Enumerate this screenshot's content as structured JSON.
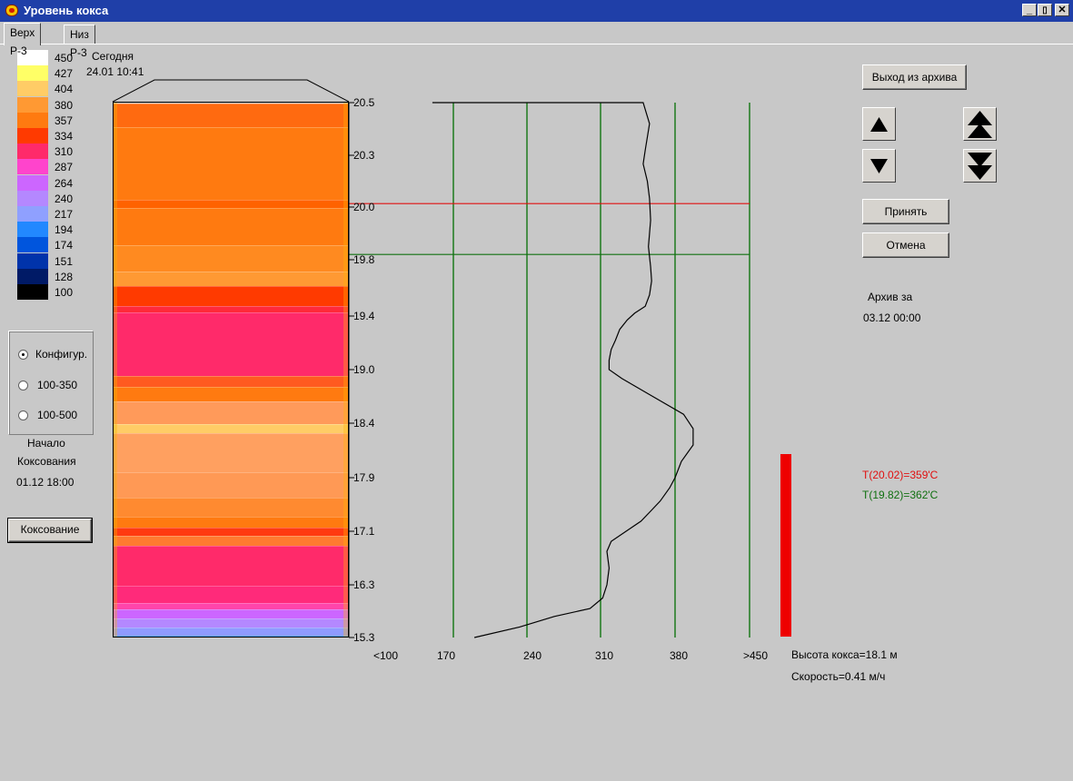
{
  "window": {
    "title": "Уровень кокса",
    "minimize": "_",
    "restore": "▯",
    "close": "✕"
  },
  "tabs": [
    {
      "label": "Верх Р-3",
      "active": true
    },
    {
      "label": "Низ Р-3",
      "active": false
    }
  ],
  "header": {
    "today_label": "Сегодня",
    "today_datetime": "24.01 10:41"
  },
  "legend": [
    {
      "value": "450",
      "color": "#ffffff"
    },
    {
      "value": "427",
      "color": "#ffff66"
    },
    {
      "value": "404",
      "color": "#ffcc66"
    },
    {
      "value": "380",
      "color": "#ff9933"
    },
    {
      "value": "357",
      "color": "#ff7a10"
    },
    {
      "value": "334",
      "color": "#ff3a00"
    },
    {
      "value": "310",
      "color": "#ff2a6a"
    },
    {
      "value": "287",
      "color": "#ff44cc"
    },
    {
      "value": "264",
      "color": "#cc66ff"
    },
    {
      "value": "240",
      "color": "#b488ff"
    },
    {
      "value": "217",
      "color": "#8fa0ff"
    },
    {
      "value": "194",
      "color": "#2288ff"
    },
    {
      "value": "174",
      "color": "#0055dd"
    },
    {
      "value": "151",
      "color": "#0033aa"
    },
    {
      "value": "128",
      "color": "#001a66"
    },
    {
      "value": "100",
      "color": "#000000"
    }
  ],
  "scale_options": {
    "selected": 0,
    "items": [
      "Конфигур.",
      "100-350",
      "100-500"
    ]
  },
  "coking_start": {
    "line1": "Начало",
    "line2": "Коксования",
    "datetime": "01.12 18:00"
  },
  "coking_button": "Коксование",
  "chart_data": {
    "type": "line",
    "title": "",
    "xlabel": "",
    "ylabel": "",
    "y_tick_labels": [
      "20.5",
      "20.3",
      "20.0",
      "19.8",
      "19.4",
      "19.0",
      "18.4",
      "17.9",
      "17.1",
      "16.3",
      "15.3"
    ],
    "x_tick_labels": [
      "<100",
      "170",
      "240",
      "310",
      "380",
      ">450"
    ],
    "ylim": [
      15.3,
      20.5
    ],
    "xlim": [
      100,
      450
    ],
    "grid": "vertical",
    "marker_lines": [
      {
        "height": 20.02,
        "color": "#e01010"
      },
      {
        "height": 19.82,
        "color": "#107010"
      }
    ],
    "series": [
      {
        "temperature": [
          150,
          350,
          356,
          352,
          350,
          354,
          356,
          357,
          355,
          357,
          358,
          356,
          352,
          342,
          335,
          328,
          324,
          320,
          318,
          318,
          330,
          356,
          388,
          397,
          397,
          386,
          380,
          375,
          366,
          357,
          348,
          334,
          320,
          316,
          318,
          316,
          312,
          300,
          266,
          233,
          190
        ],
        "height": [
          20.5,
          20.5,
          20.42,
          20.32,
          20.25,
          20.15,
          20.05,
          19.95,
          19.85,
          19.75,
          19.65,
          19.55,
          19.47,
          19.42,
          19.37,
          19.3,
          19.22,
          19.15,
          19.07,
          19.0,
          18.9,
          18.72,
          18.5,
          18.35,
          18.2,
          18.05,
          17.9,
          17.75,
          17.55,
          17.4,
          17.25,
          17.1,
          16.95,
          16.8,
          16.55,
          16.3,
          16.05,
          15.85,
          15.7,
          15.5,
          15.3
        ]
      }
    ],
    "heatmap_bands": [
      {
        "from": 20.5,
        "to": 20.41,
        "color": "#ff6a10"
      },
      {
        "from": 20.41,
        "to": 20.05,
        "color": "#ff7a10"
      },
      {
        "from": 20.05,
        "to": 20.0,
        "color": "#ff6200"
      },
      {
        "from": 20.0,
        "to": 19.86,
        "color": "#ff7a10"
      },
      {
        "from": 19.86,
        "to": 19.72,
        "color": "#ff8a20"
      },
      {
        "from": 19.72,
        "to": 19.62,
        "color": "#ff9933"
      },
      {
        "from": 19.62,
        "to": 19.48,
        "color": "#ff3a00"
      },
      {
        "from": 19.48,
        "to": 19.43,
        "color": "#ff2a3a"
      },
      {
        "from": 19.43,
        "to": 18.94,
        "color": "#ff2a6a"
      },
      {
        "from": 18.94,
        "to": 18.82,
        "color": "#ff5a20"
      },
      {
        "from": 18.82,
        "to": 18.65,
        "color": "#ff7a10"
      },
      {
        "from": 18.65,
        "to": 18.4,
        "color": "#ff9a5a"
      },
      {
        "from": 18.4,
        "to": 18.32,
        "color": "#ffcc66"
      },
      {
        "from": 18.32,
        "to": 17.96,
        "color": "#ffa060"
      },
      {
        "from": 17.96,
        "to": 17.62,
        "color": "#ff9955"
      },
      {
        "from": 17.62,
        "to": 17.33,
        "color": "#ff8a30"
      },
      {
        "from": 17.33,
        "to": 17.17,
        "color": "#ff7a10"
      },
      {
        "from": 17.17,
        "to": 17.05,
        "color": "#ff3a10"
      },
      {
        "from": 17.05,
        "to": 16.9,
        "color": "#ff7a30"
      },
      {
        "from": 16.9,
        "to": 16.3,
        "color": "#ff2a6a"
      },
      {
        "from": 16.3,
        "to": 15.98,
        "color": "#ff2a7a"
      },
      {
        "from": 15.98,
        "to": 15.86,
        "color": "#ff44aa"
      },
      {
        "from": 15.86,
        "to": 15.68,
        "color": "#cc66ff"
      },
      {
        "from": 15.68,
        "to": 15.5,
        "color": "#b488ff"
      },
      {
        "from": 15.5,
        "to": 15.35,
        "color": "#8f9aff"
      },
      {
        "from": 15.35,
        "to": 15.3,
        "color": "#2288ff"
      }
    ]
  },
  "buttons": {
    "exit_archive": "Выход из архива",
    "accept": "Принять",
    "cancel": "Отмена"
  },
  "archive": {
    "label": "Архив за",
    "datetime": "03.12 00:00"
  },
  "temps": {
    "red": "T(20.02)=359'C",
    "green": "T(19.82)=362'C"
  },
  "level": {
    "value": 18.1
  },
  "status": {
    "height": "Высота кокса=18.1 м",
    "speed": "Скорость=0.41 м/ч"
  },
  "colors": {
    "title_bar": "#1f3fa8",
    "red_line": "#e01010",
    "green_line": "#107010",
    "grid": "#1e7a1e",
    "level_bar": "#ee0000"
  }
}
